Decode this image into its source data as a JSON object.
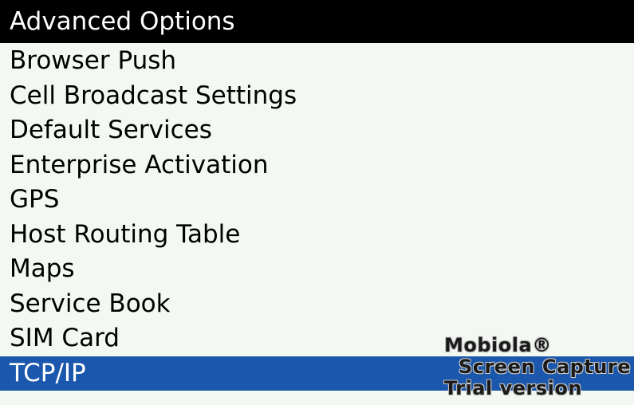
{
  "screen": {
    "title": "Advanced Options",
    "colors": {
      "title_bar": "#000000",
      "background": "#f3f9f2",
      "selection": "#1b57ac"
    }
  },
  "menu": {
    "items": [
      {
        "label": "Browser Push"
      },
      {
        "label": "Cell Broadcast Settings"
      },
      {
        "label": "Default Services"
      },
      {
        "label": "Enterprise Activation"
      },
      {
        "label": "GPS"
      },
      {
        "label": "Host Routing Table"
      },
      {
        "label": "Maps"
      },
      {
        "label": "Service Book"
      },
      {
        "label": "SIM Card"
      },
      {
        "label": "TCP/IP",
        "selected": true
      }
    ]
  },
  "watermark": {
    "line1": "Mobiola®",
    "line2": "Screen Capture",
    "line3": "Trial version"
  }
}
